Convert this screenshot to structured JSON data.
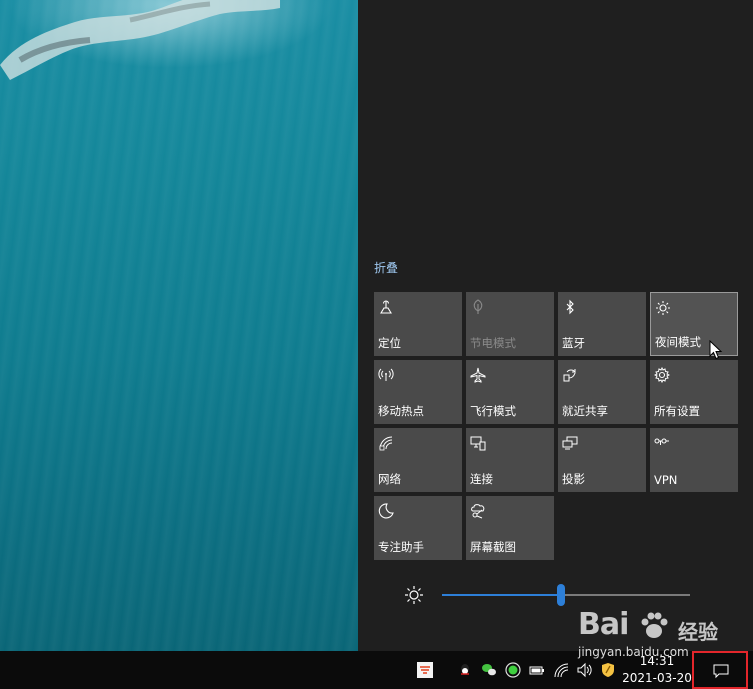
{
  "action_center": {
    "collapse_label": "折叠",
    "tiles": [
      {
        "label": "定位",
        "icon": "location-icon",
        "state": "normal"
      },
      {
        "label": "节电模式",
        "icon": "battery-saver-icon",
        "state": "disabled"
      },
      {
        "label": "蓝牙",
        "icon": "bluetooth-icon",
        "state": "normal"
      },
      {
        "label": "夜间模式",
        "icon": "night-light-icon",
        "state": "selected"
      },
      {
        "label": "移动热点",
        "icon": "mobile-hotspot-icon",
        "state": "normal"
      },
      {
        "label": "飞行模式",
        "icon": "airplane-icon",
        "state": "normal"
      },
      {
        "label": "就近共享",
        "icon": "nearby-share-icon",
        "state": "normal"
      },
      {
        "label": "所有设置",
        "icon": "gear-icon",
        "state": "normal"
      },
      {
        "label": "网络",
        "icon": "network-icon",
        "state": "normal"
      },
      {
        "label": "连接",
        "icon": "connect-icon",
        "state": "normal"
      },
      {
        "label": "投影",
        "icon": "project-icon",
        "state": "normal"
      },
      {
        "label": "VPN",
        "icon": "vpn-icon",
        "state": "normal"
      },
      {
        "label": "专注助手",
        "icon": "focus-assist-icon",
        "state": "normal"
      },
      {
        "label": "屏幕截图",
        "icon": "screen-snip-icon",
        "state": "normal"
      }
    ],
    "brightness_percent": 48
  },
  "taskbar": {
    "time": "14:31",
    "date": "2021-03-20",
    "tray_icons": [
      "app-icon",
      "qq-icon",
      "wechat-icon",
      "green-circle-icon",
      "battery-icon",
      "wifi-icon",
      "volume-icon",
      "shield-icon"
    ]
  },
  "watermark": {
    "brand": "Bai",
    "brand_suffix": "经验",
    "url": "jingyan.baidu.com"
  },
  "colors": {
    "accent": "#2d7fd8",
    "tile_bg": "#4a4a4a",
    "panel_bg": "#1f1f1f",
    "highlight_box": "#e3262b"
  }
}
